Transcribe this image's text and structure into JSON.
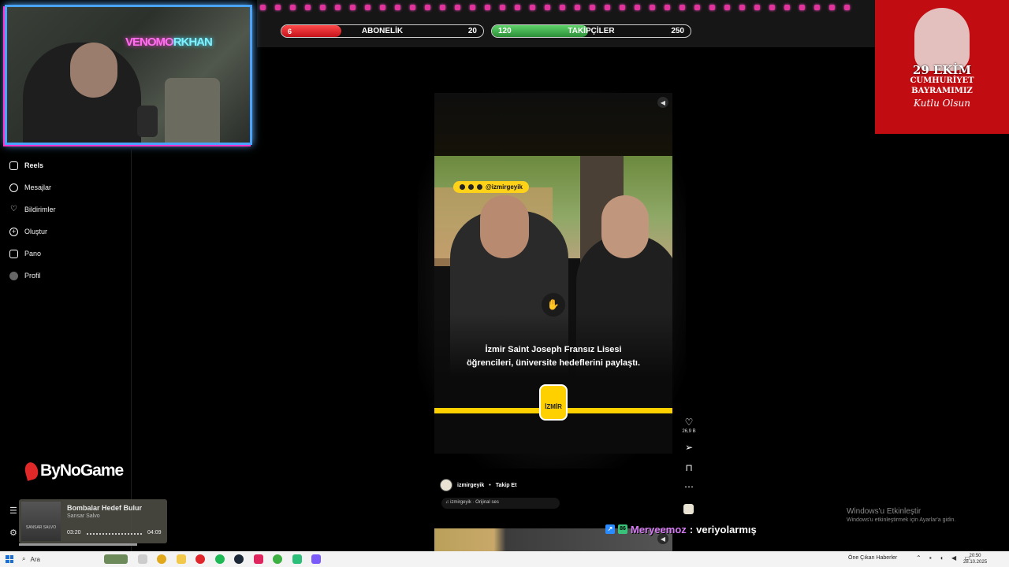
{
  "stream": {
    "subscriber_goal": {
      "label": "ABONELİK",
      "current": "6",
      "target": "20",
      "progress": 0.3,
      "color": "#e3242b"
    },
    "follower_goal": {
      "label": "TAKİPÇİLER",
      "current": "120",
      "target": "250",
      "progress": 0.48,
      "color": "#3bb54a"
    },
    "webcam_sign": {
      "part1": "VENOMO",
      "part2": "RKHAN"
    },
    "banner": {
      "line1": "29 EKİM",
      "line2": "CUMHURİYET",
      "line3": "BAYRAMIMIZ",
      "line4": "Kutlu Olsun"
    },
    "sponsor": "ByNoGame",
    "chat": {
      "nick": "Meryeemoz",
      "separator": ":",
      "message": "veriyolarmış"
    },
    "now_playing": {
      "title": "Bombalar Hedef Bulur",
      "artist": "Sansar Salvo",
      "elapsed": "03:20",
      "duration": "04:09",
      "art_text": "SANSAR SALVO"
    }
  },
  "sidebar": {
    "items": [
      {
        "label": "Reels",
        "icon": "reels-icon"
      },
      {
        "label": "Mesajlar",
        "icon": "messenger-icon"
      },
      {
        "label": "Bildirimler",
        "icon": "heart-icon"
      },
      {
        "label": "Oluştur",
        "icon": "plus-icon"
      },
      {
        "label": "Pano",
        "icon": "dashboard-icon"
      },
      {
        "label": "Profil",
        "icon": "avatar-icon"
      }
    ]
  },
  "reel": {
    "tag": "@izmirgeyik",
    "caption_line1": "İzmir Saint Joseph Fransız Lisesi",
    "caption_line2": "öğrencileri, üniversite hedeflerini paylaştı.",
    "logo_text": "İZMİR",
    "likes": "26,9 B",
    "username": "izmirgeyik",
    "dot": "•",
    "follow_label": "Takip Et",
    "audio": "izmirgeyik · Orijinal ses"
  },
  "windows": {
    "activate_title": "Windows'u Etkinleştir",
    "activate_sub": "Windows'u etkinleştirmek için Ayarlar'a gidin.",
    "search_placeholder": "Ara",
    "news": "Öne Çıkan Haberler",
    "time": "20:50",
    "date": "28.10.2025"
  }
}
